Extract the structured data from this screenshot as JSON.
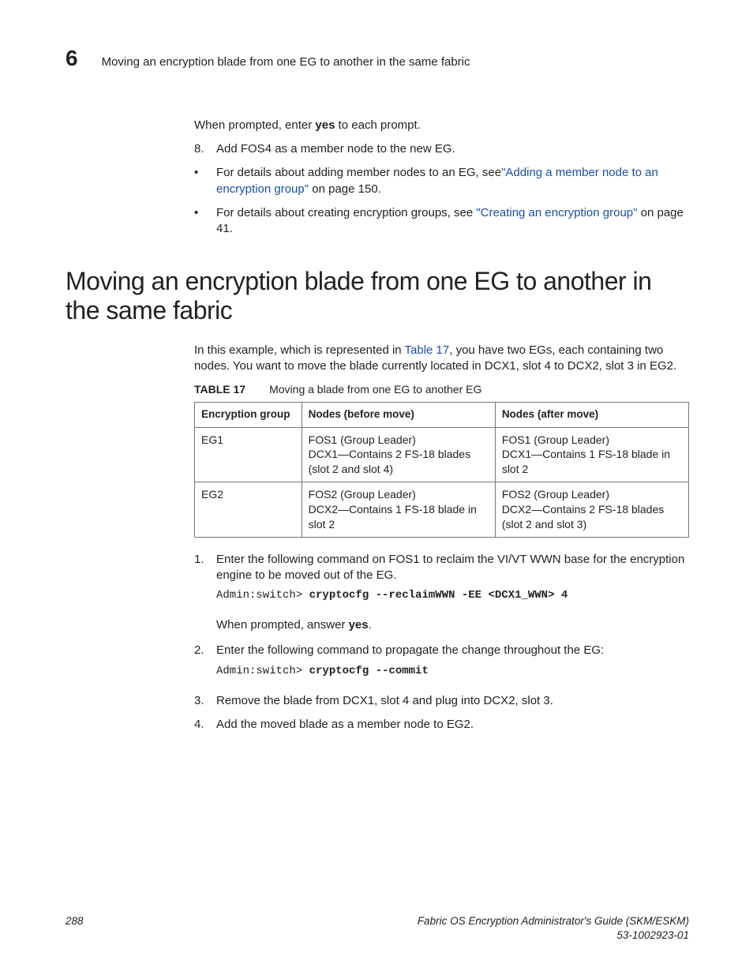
{
  "header": {
    "chapter_number": "6",
    "running_title": "Moving an encryption blade from one EG to another in the same fabric"
  },
  "top_block": {
    "prompt_line_prefix": "When prompted, enter ",
    "prompt_line_bold": "yes",
    "prompt_line_suffix": " to each prompt.",
    "step8_marker": "8.",
    "step8_text": "Add FOS4 as a member node to the new EG.",
    "bullet1_prefix": "For details about adding member nodes to an EG, see",
    "bullet1_link": "\"Adding a member node to an encryption group\"",
    "bullet1_suffix": " on page 150.",
    "bullet2_prefix": "For details about creating encryption groups, see ",
    "bullet2_link": "\"Creating an encryption group\"",
    "bullet2_suffix": " on page 41."
  },
  "section_title": "Moving an encryption blade from one EG to another in the same fabric",
  "intro_prefix": "In this example, which is represented in ",
  "intro_link": "Table 17",
  "intro_suffix": ", you have two EGs, each containing two nodes. You want to move the blade currently located in DCX1, slot 4 to DCX2, slot 3 in EG2.",
  "table": {
    "label_num": "TABLE 17",
    "label_caption": "Moving a blade from one EG to another EG",
    "headers": [
      "Encryption group",
      "Nodes (before move)",
      "Nodes (after move)"
    ],
    "rows": [
      {
        "eg": "EG1",
        "before_l1": "FOS1 (Group Leader)",
        "before_l2": "DCX1—Contains 2 FS-18 blades (slot 2 and slot 4)",
        "after_l1": "FOS1 (Group Leader)",
        "after_l2": "DCX1—Contains 1 FS-18 blade in slot 2"
      },
      {
        "eg": "EG2",
        "before_l1": "FOS2 (Group Leader)",
        "before_l2": "DCX2—Contains 1 FS-18 blade in slot 2",
        "after_l1": "FOS2 (Group Leader)",
        "after_l2": "DCX2—Contains 2 FS-18 blades (slot 2 and slot 3)"
      }
    ]
  },
  "steps": {
    "s1_marker": "1.",
    "s1_text": "Enter the following command on FOS1 to reclaim the VI/VT WWN base for the encryption engine to be moved out of the EG.",
    "s1_code_plain": "Admin:switch> ",
    "s1_code_bold": "cryptocfg --reclaimWWN -EE <DCX1_WWN> 4",
    "s1_followup_prefix": "When prompted, answer ",
    "s1_followup_bold": "yes",
    "s1_followup_suffix": ".",
    "s2_marker": "2.",
    "s2_text": "Enter the following command to propagate the change throughout the EG:",
    "s2_code_plain": "Admin:switch> ",
    "s2_code_bold": "cryptocfg --commit",
    "s3_marker": "3.",
    "s3_text": "Remove the blade from DCX1, slot 4 and plug into DCX2, slot 3.",
    "s4_marker": "4.",
    "s4_text": "Add the moved blade as a member node to EG2."
  },
  "footer": {
    "page_number": "288",
    "title": "Fabric OS Encryption Administrator's Guide (SKM/ESKM)",
    "docnum": "53-1002923-01"
  }
}
